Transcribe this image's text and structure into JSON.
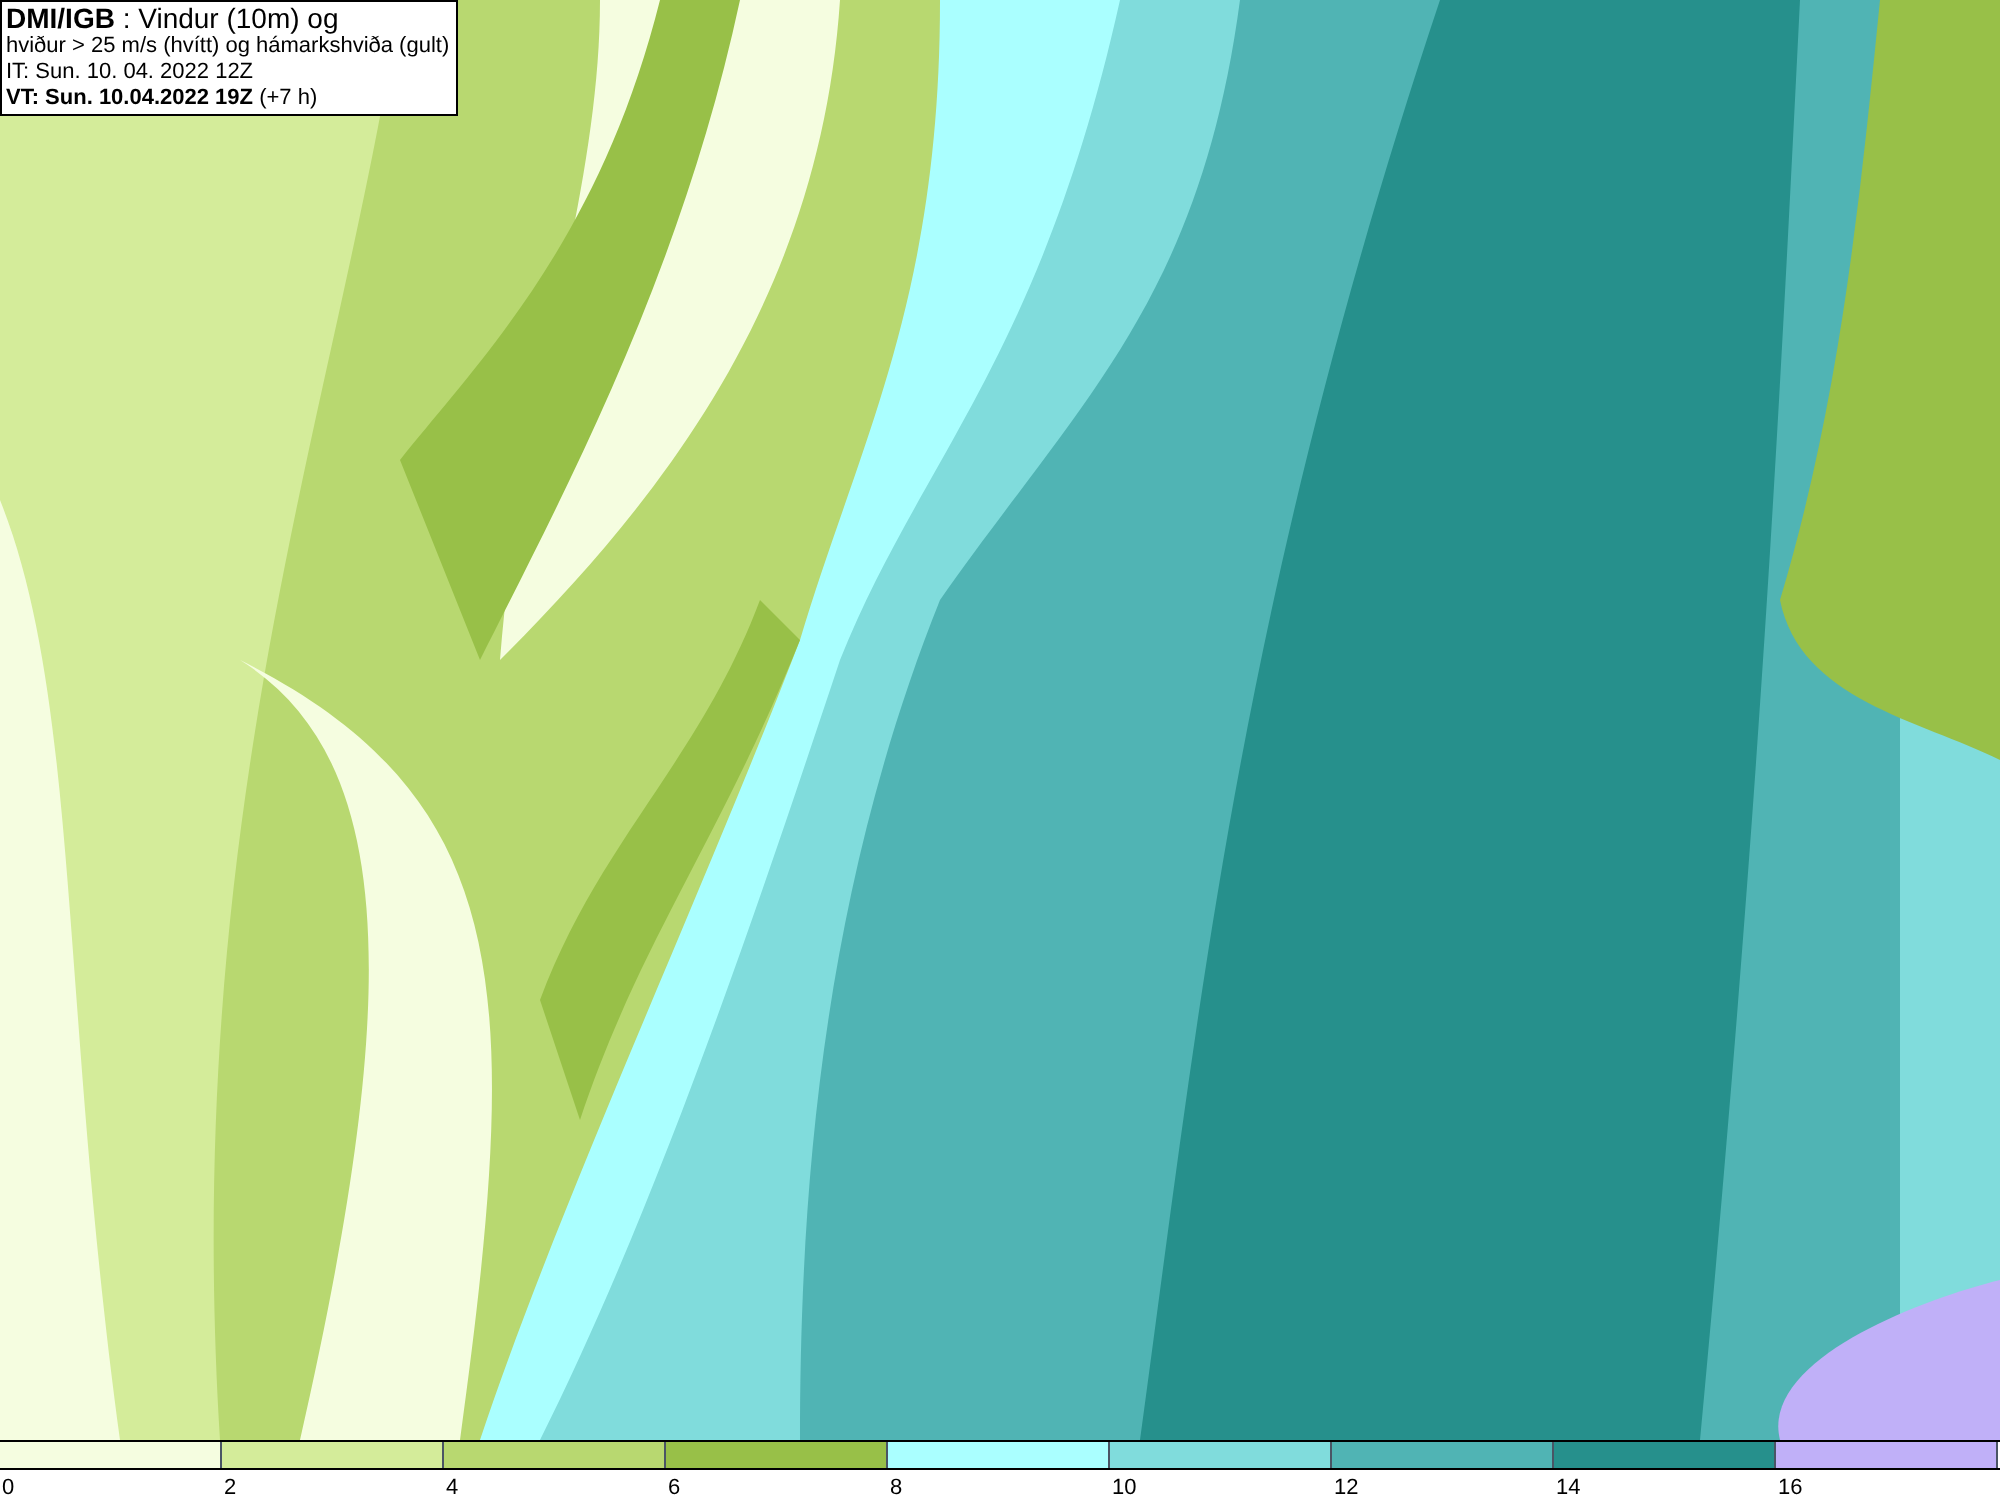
{
  "header": {
    "lines": [
      "**DMI/IGB** : Vindur (10m) og",
      "hviður > 25 m/s (hvítt) og hámarkshviða (gult)",
      "IT: Sun. 10. 04. 2022 12Z",
      "**VT: Sun. 10.04.2022 19Z** (+7 h)"
    ]
  },
  "legend": {
    "bins": [
      {
        "color": "#f5fde0"
      },
      {
        "color": "#d4ec9a"
      },
      {
        "color": "#b8d870"
      },
      {
        "color": "#98c048"
      },
      {
        "color": "#aaffff"
      },
      {
        "color": "#80dcdc"
      },
      {
        "color": "#50b4b4"
      },
      {
        "color": "#26908c"
      },
      {
        "color": "#c0b0f8"
      }
    ],
    "ticks": [
      "0",
      "2",
      "4",
      "6",
      "8",
      "10",
      "12",
      "14",
      "16"
    ]
  }
}
